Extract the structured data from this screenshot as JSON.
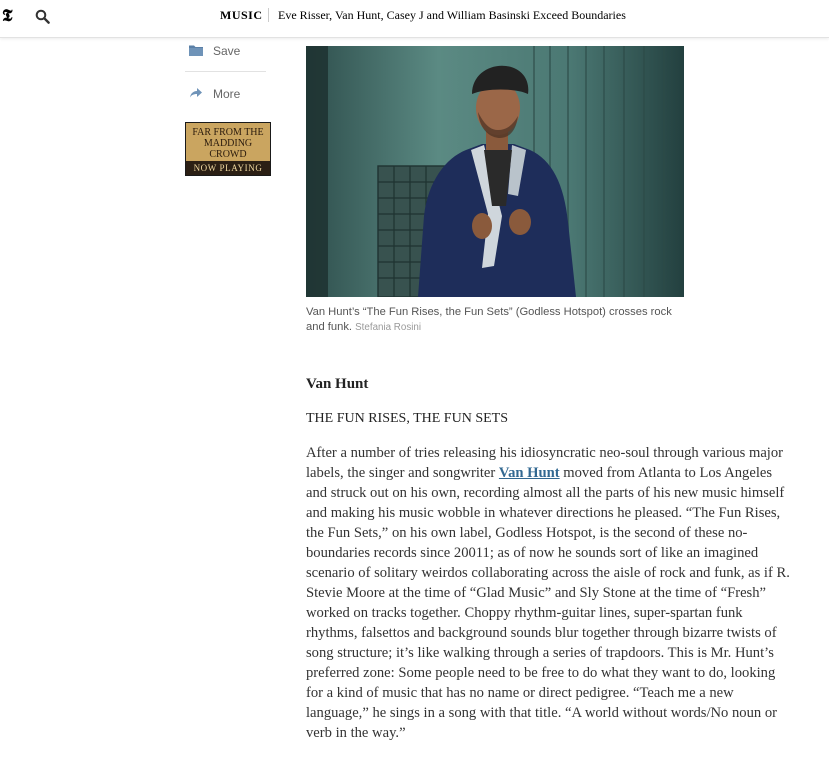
{
  "header": {
    "logo_glyph": "𝕿",
    "section": "MUSIC",
    "headline": "Eve Risser, Van Hunt, Casey J and William Basinski Exceed Boundaries"
  },
  "share": {
    "save_label": "Save",
    "more_label": "More"
  },
  "ad": {
    "line1": "FAR FROM THE",
    "line2": "MADDING CROWD",
    "line3": "NOW PLAYING"
  },
  "photo": {
    "caption": "Van Hunt’s “The Fun Rises, the Fun Sets” (Godless Hotspot) crosses rock and funk.",
    "credit": "Stefania Rosini"
  },
  "article": {
    "artist": "Van Hunt",
    "album": "THE FUN RISES, THE FUN SETS",
    "body_before": "After a number of tries releasing his idiosyncratic neo-soul through various major labels, the singer and songwriter ",
    "body_link": "Van Hunt",
    "body_after": " moved from Atlanta to Los Angeles and struck out on his own, recording almost all the parts of his new music himself and making his music wobble in whatever directions he pleased. “The Fun Rises, the Fun Sets,” on his own label, Godless Hotspot, is the second of these no-boundaries records since 20011; as of now he sounds sort of like an imagined scenario of solitary weirdos collaborating across the aisle of rock and funk, as if R. Stevie Moore at the time of “Glad Music” and Sly Stone at the time of “Fresh” worked on tracks together. Choppy rhythm-guitar lines, super-spartan funk rhythms, falsettos and background sounds blur together through bizarre twists of song structure; it’s like walking through a series of trapdoors. This is Mr. Hunt’s preferred zone: Some people need to be free to do what they want to do, looking for a kind of music that has no name or direct pedigree. “Teach me a new language,” he sings in a song with that title. “A world without words/No noun or verb in the way.”"
  },
  "colors": {
    "link": "#326891",
    "ad_background": "#caa560"
  }
}
